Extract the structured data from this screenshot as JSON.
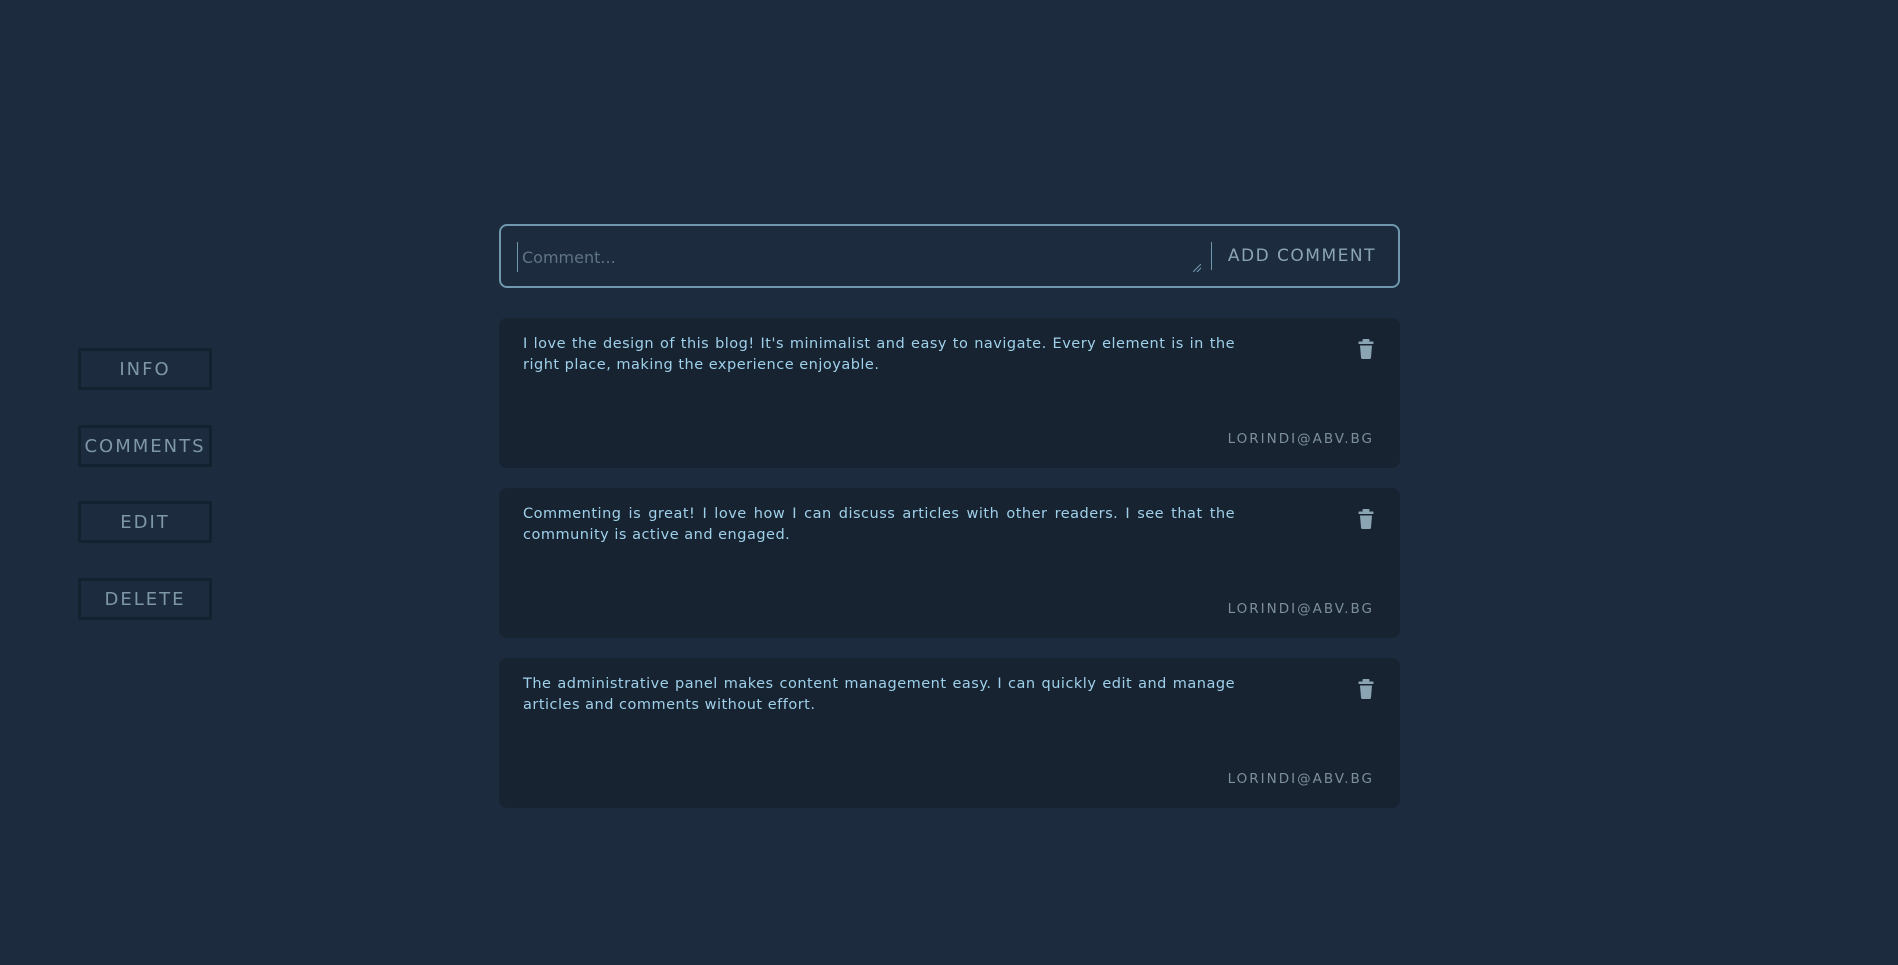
{
  "sidebar": {
    "info_label": "INFO",
    "comments_label": "COMMENTS",
    "edit_label": "EDIT",
    "delete_label": "DELETE"
  },
  "comment_form": {
    "placeholder": "Comment...",
    "value": "",
    "submit_label": "ADD COMMENT"
  },
  "comments": [
    {
      "text": "I love the design of this blog! It's minimalist and easy to navigate. Every element is in the right place, making the experience enjoyable.",
      "author": "LORINDI@ABV.BG",
      "delete_icon": "trash-icon"
    },
    {
      "text": "Commenting is great! I love how I can discuss articles with other readers. I see that the community is active and engaged.",
      "author": "LORINDI@ABV.BG",
      "delete_icon": "trash-icon"
    },
    {
      "text": "The administrative panel makes content management easy. I can quickly edit and manage articles and comments without effort.",
      "author": "LORINDI@ABV.BG",
      "delete_icon": "trash-icon"
    }
  ],
  "colors": {
    "background": "#1c2b3e",
    "card": "#172331",
    "accent_text": "#9fd0ea",
    "border": "#6f98ad"
  }
}
